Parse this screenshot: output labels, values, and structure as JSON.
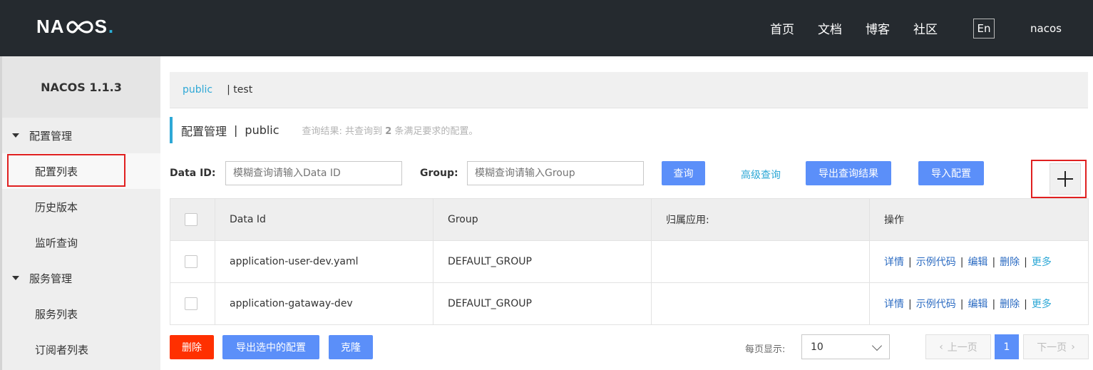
{
  "header": {
    "logo": {
      "n": "N",
      "a": "A",
      "c": "C",
      "s": "S",
      "dot": "."
    },
    "nav": [
      "首页",
      "文档",
      "博客",
      "社区"
    ],
    "lang": "En",
    "user": "nacos"
  },
  "sidebar": {
    "title": "NACOS 1.1.3",
    "groups": [
      {
        "label": "配置管理",
        "items": [
          "配置列表",
          "历史版本",
          "监听查询"
        ]
      },
      {
        "label": "服务管理",
        "items": [
          "服务列表",
          "订阅者列表"
        ]
      }
    ]
  },
  "breadcrumb": {
    "public": "public",
    "test": "| test"
  },
  "page_head": {
    "title": "配置管理",
    "sep": "|",
    "namespace": "public",
    "desc_prefix": "查询结果: 共查询到",
    "count": "2",
    "desc_suffix": "条满足要求的配置。"
  },
  "search": {
    "data_id_label": "Data ID:",
    "data_id_placeholder": "模糊查询请输入Data ID",
    "group_label": "Group:",
    "group_placeholder": "模糊查询请输入Group",
    "query_btn": "查询",
    "advanced": "高级查询",
    "export_results": "导出查询结果",
    "import": "导入配置",
    "add": "+"
  },
  "table": {
    "headers": [
      "Data Id",
      "Group",
      "归属应用:",
      "操作"
    ],
    "rows": [
      {
        "data_id": "application-user-dev.yaml",
        "group": "DEFAULT_GROUP",
        "app": ""
      },
      {
        "data_id": "application-gataway-dev",
        "group": "DEFAULT_GROUP",
        "app": ""
      }
    ],
    "ops": {
      "detail": "详情",
      "sample": "示例代码",
      "edit": "编辑",
      "delete": "删除",
      "more": "更多",
      "sep": "|"
    }
  },
  "footer": {
    "delete": "删除",
    "export_selected": "导出选中的配置",
    "clone": "克隆",
    "page_size_label": "每页显示:",
    "page_size": "10",
    "prev": "上一页",
    "current": "1",
    "next": "下一页"
  },
  "colors": {
    "accent": "#5b8ff9",
    "link": "#2ea8d6",
    "danger": "#ff3000",
    "header_bg": "#252a2f",
    "highlight": "#e02020"
  }
}
